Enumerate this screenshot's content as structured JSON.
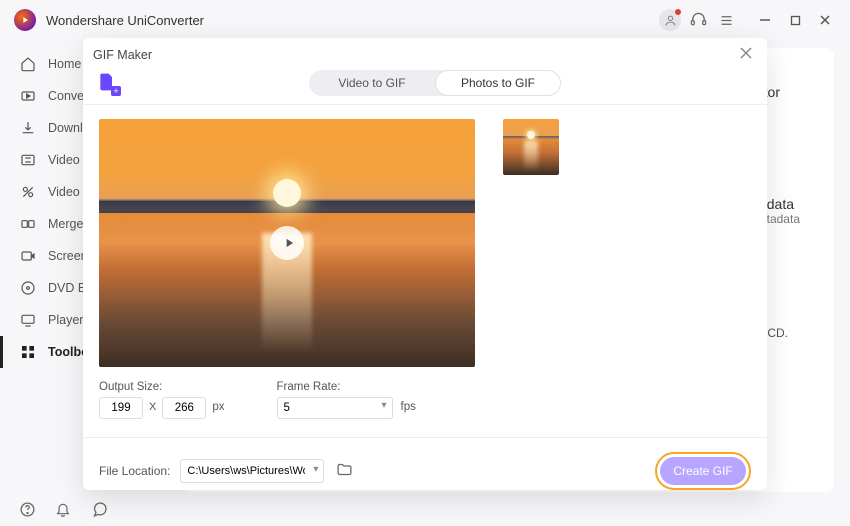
{
  "app": {
    "title": "Wondershare UniConverter"
  },
  "sidebar": {
    "items": [
      {
        "label": "Home"
      },
      {
        "label": "Converter"
      },
      {
        "label": "Downloader"
      },
      {
        "label": "Video Compressor"
      },
      {
        "label": "Video Editor"
      },
      {
        "label": "Merger"
      },
      {
        "label": "Screen Recorder"
      },
      {
        "label": "DVD Burner"
      },
      {
        "label": "Player"
      },
      {
        "label": "Toolbox"
      }
    ]
  },
  "background_peek": {
    "line1": "tor",
    "line2": "data",
    "line3": "etadata",
    "line4": "CD."
  },
  "modal": {
    "title": "GIF Maker",
    "tabs": {
      "video": "Video to GIF",
      "photos": "Photos to GIF"
    },
    "output_size_label": "Output Size:",
    "width": "199",
    "height": "266",
    "dim_sep": "X",
    "px_unit": "px",
    "frame_rate_label": "Frame Rate:",
    "frame_rate": "5",
    "fps_unit": "fps",
    "file_location_label": "File Location:",
    "file_location": "C:\\Users\\ws\\Pictures\\Wonders",
    "create_button": "Create GIF"
  }
}
